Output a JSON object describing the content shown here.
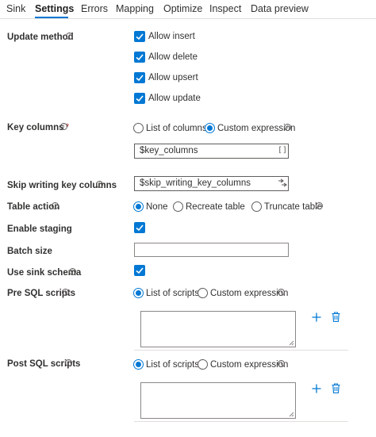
{
  "tabs": [
    {
      "label": "Sink"
    },
    {
      "label": "Settings"
    },
    {
      "label": "Errors"
    },
    {
      "label": "Mapping"
    },
    {
      "label": "Optimize"
    },
    {
      "label": "Inspect"
    },
    {
      "label": "Data preview"
    }
  ],
  "accent_color": "#0078d4",
  "update_method": {
    "label": "Update method",
    "options": [
      {
        "label": "Allow insert",
        "checked": true
      },
      {
        "label": "Allow delete",
        "checked": true
      },
      {
        "label": "Allow upsert",
        "checked": true
      },
      {
        "label": "Allow update",
        "checked": true
      }
    ]
  },
  "key_columns": {
    "label": "Key columns",
    "required_mark": "*",
    "options": [
      {
        "label": "List of columns",
        "selected": false
      },
      {
        "label": "Custom expression",
        "selected": true
      }
    ],
    "value": "$key_columns",
    "expr_icon": "[]"
  },
  "skip_writing": {
    "label": "Skip writing key columns",
    "value": "$skip_writing_key_columns",
    "icon": "dynamic-content-icon"
  },
  "table_action": {
    "label": "Table action",
    "options": [
      {
        "label": "None",
        "selected": true
      },
      {
        "label": "Recreate table",
        "selected": false
      },
      {
        "label": "Truncate table",
        "selected": false
      }
    ]
  },
  "enable_staging": {
    "label": "Enable staging",
    "checked": true
  },
  "batch_size": {
    "label": "Batch size",
    "value": ""
  },
  "use_sink_schema": {
    "label": "Use sink schema",
    "checked": true
  },
  "pre_sql": {
    "label": "Pre SQL scripts",
    "options": [
      {
        "label": "List of scripts",
        "selected": true
      },
      {
        "label": "Custom expression",
        "selected": false
      }
    ]
  },
  "post_sql": {
    "label": "Post SQL scripts",
    "options": [
      {
        "label": "List of scripts",
        "selected": true
      },
      {
        "label": "Custom expression",
        "selected": false
      }
    ]
  }
}
